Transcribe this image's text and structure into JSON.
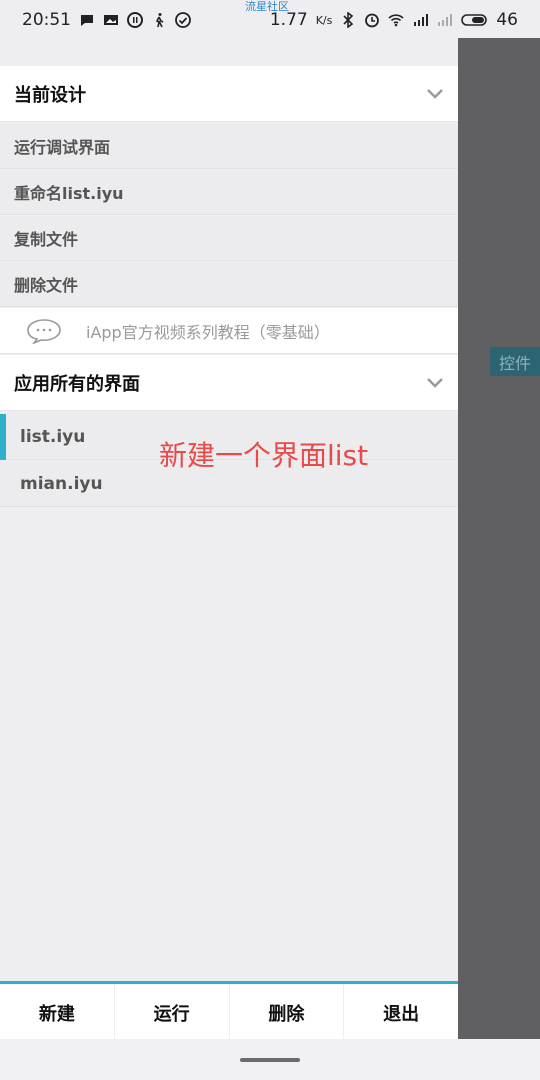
{
  "status_bar": {
    "time": "20:51",
    "speed": "1.77",
    "speed_unit": "K/s",
    "battery": "46",
    "watermark": "流星社区"
  },
  "current_design": {
    "title": "当前设计",
    "items": [
      "运行调试界面",
      "重命名list.iyu",
      "复制文件",
      "删除文件"
    ],
    "tutorial_text": "iApp官方视频系列教程（零基础）"
  },
  "app_screens": {
    "title": "应用所有的界面",
    "items": [
      {
        "label": "list.iyu",
        "selected": true
      },
      {
        "label": "mian.iyu",
        "selected": false
      }
    ],
    "annotation": "新建一个界面list"
  },
  "right_panel": {
    "chip": "控件"
  },
  "bottom_bar": {
    "new_label": "新建",
    "run_label": "运行",
    "delete_label": "删除",
    "exit_label": "退出"
  },
  "colors": {
    "accent": "#2fb0c9",
    "annotation": "#e84a4a",
    "overlay": "#606062"
  }
}
